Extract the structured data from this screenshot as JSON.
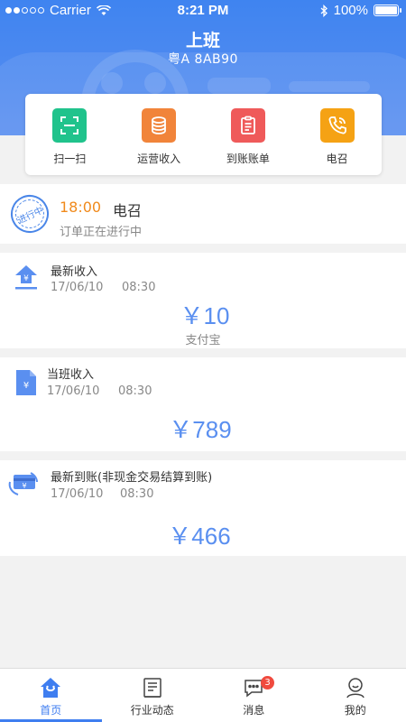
{
  "status_bar": {
    "carrier": "Carrier",
    "time": "8:21 PM",
    "battery": "100%"
  },
  "header": {
    "title": "上班",
    "plate": "粤A 8AB90"
  },
  "quick_actions": [
    {
      "label": "扫一扫",
      "icon": "scan-icon",
      "color": "#20c38c"
    },
    {
      "label": "运营收入",
      "icon": "coins-icon",
      "color": "#f1843a"
    },
    {
      "label": "到账账单",
      "icon": "clipboard-icon",
      "color": "#ef5a5a"
    },
    {
      "label": "电召",
      "icon": "phone-icon",
      "color": "#f5a214"
    }
  ],
  "order": {
    "stamp": "进行中",
    "time": "18:00",
    "type": "电召",
    "status": "订单正在进行中"
  },
  "latest_income": {
    "title": "最新收入",
    "date": "17/06/10",
    "time": "08:30",
    "amount": "￥10",
    "method": "支付宝"
  },
  "shift_income": {
    "title": "当班收入",
    "date": "17/06/10",
    "time": "08:30",
    "amount": "￥789"
  },
  "latest_settlement": {
    "title": "最新到账(非现金交易结算到账)",
    "date": "17/06/10",
    "time": "08:30",
    "amount": "￥466"
  },
  "tabs": [
    {
      "label": "首页",
      "icon": "home-icon",
      "active": true
    },
    {
      "label": "行业动态",
      "icon": "news-icon"
    },
    {
      "label": "消息",
      "icon": "message-icon",
      "badge": "3"
    },
    {
      "label": "我的",
      "icon": "profile-icon"
    }
  ],
  "colors": {
    "primary": "#3f7ef0",
    "amount": "#5a8ff0",
    "orange": "#f08a1c"
  }
}
